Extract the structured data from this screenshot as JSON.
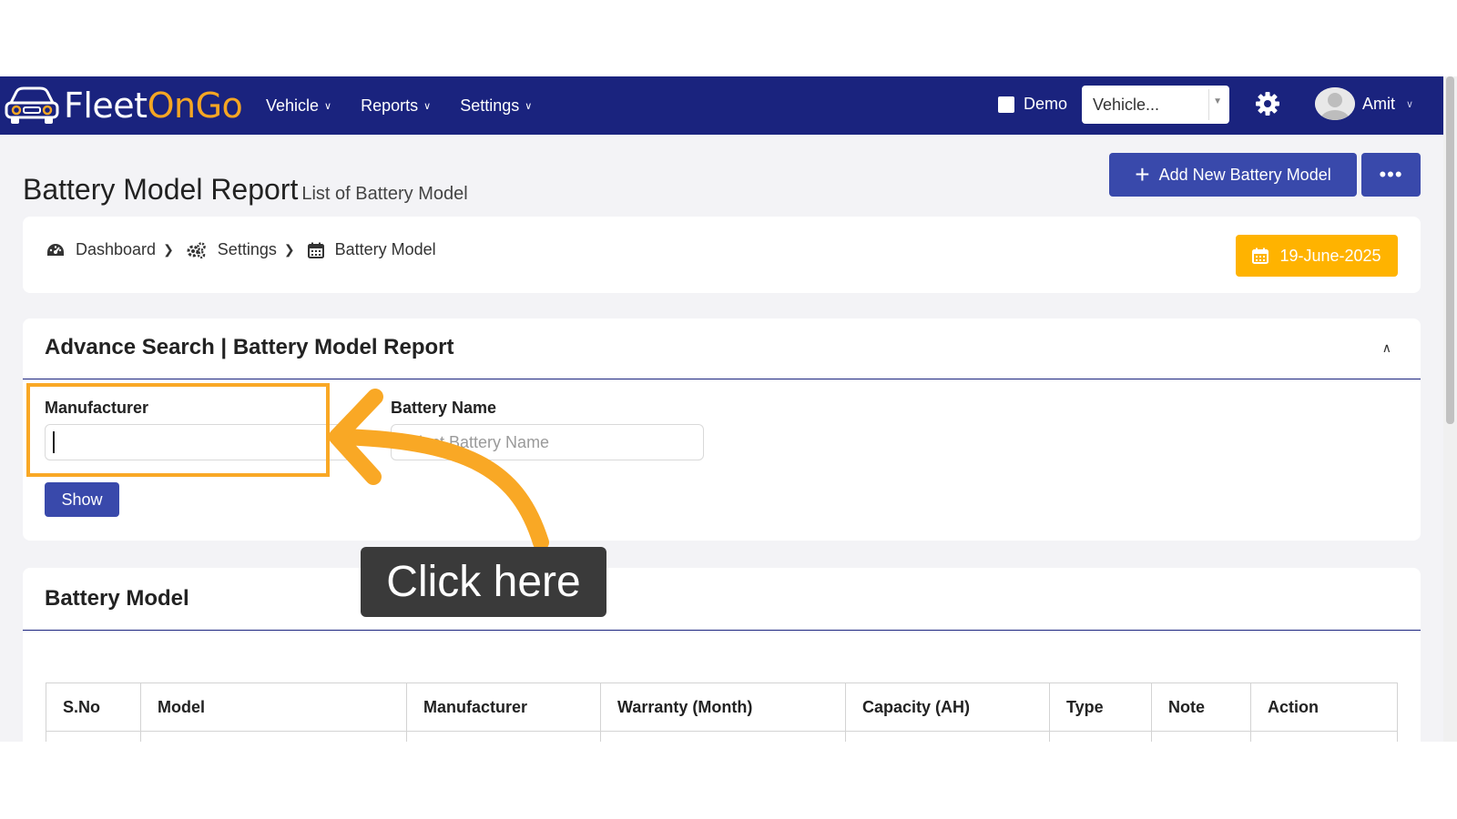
{
  "brand": {
    "name_prefix": "Fleet",
    "name_on": "On",
    "name_go": "Go"
  },
  "nav": {
    "items": [
      {
        "label": "Vehicle"
      },
      {
        "label": "Reports"
      },
      {
        "label": "Settings"
      }
    ],
    "demo_label": "Demo",
    "vehicle_select_value": "Vehicle...",
    "user_name": "Amit"
  },
  "page": {
    "title": "Battery Model Report",
    "subtitle": "List of Battery Model",
    "add_button_label": "Add New Battery Model",
    "more_button_label": "•••"
  },
  "breadcrumb": {
    "items": [
      {
        "label": "Dashboard",
        "icon": "dashboard-icon"
      },
      {
        "label": "Settings",
        "icon": "cogs-icon"
      },
      {
        "label": "Battery Model",
        "icon": "calendar-icon"
      }
    ],
    "date_label": "19-June-2025"
  },
  "search": {
    "title": "Advance Search | Battery Model Report",
    "manufacturer_label": "Manufacturer",
    "manufacturer_value": "",
    "battery_name_label": "Battery Name",
    "battery_name_placeholder": "Select Battery Name",
    "show_button_label": "Show"
  },
  "list": {
    "title": "Battery Model",
    "columns": [
      "S.No",
      "Model",
      "Manufacturer",
      "Warranty (Month)",
      "Capacity (AH)",
      "Type",
      "Note",
      "Action"
    ]
  },
  "annotation": {
    "callout_text": "Click here",
    "highlight_color": "#f9a825"
  },
  "colors": {
    "navbar": "#1a237e",
    "primary_button": "#3949ab",
    "date_button": "#ffb300",
    "brand_accent": "#f5a623"
  }
}
